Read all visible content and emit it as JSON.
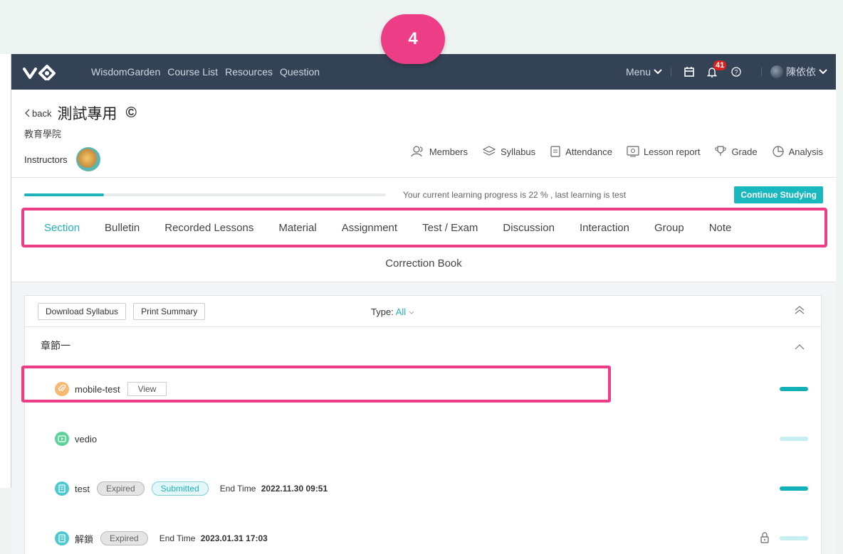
{
  "step_badge": "4",
  "topbar": {
    "brand": "WisdomGarden",
    "nav": [
      "Course List",
      "Resources",
      "Question"
    ],
    "menu_label": "Menu",
    "notification_count": "41",
    "user_name": "陳依依"
  },
  "course": {
    "back_label": "back",
    "title": "測試專用",
    "copyright_symbol": "©",
    "college": "教育學院",
    "instructors_label": "Instructors"
  },
  "tools": [
    {
      "label": "Members",
      "icon": "members-icon"
    },
    {
      "label": "Syllabus",
      "icon": "syllabus-icon"
    },
    {
      "label": "Attendance",
      "icon": "attendance-icon"
    },
    {
      "label": "Lesson report",
      "icon": "lesson-report-icon"
    },
    {
      "label": "Grade",
      "icon": "trophy-icon"
    },
    {
      "label": "Analysis",
      "icon": "pie-icon"
    }
  ],
  "progress": {
    "percent": 22,
    "text": "Your current learning progress is 22 % , last learning is test",
    "continue_label": "Continue Studying"
  },
  "tabs": [
    "Section",
    "Bulletin",
    "Recorded Lessons",
    "Material",
    "Assignment",
    "Test / Exam",
    "Discussion",
    "Interaction",
    "Group",
    "Note"
  ],
  "active_tab": "Section",
  "tab_second_row": "Correction Book",
  "toolbar": {
    "download_label": "Download Syllabus",
    "print_label": "Print Summary",
    "type_label": "Type:",
    "type_value": "All"
  },
  "chapter": {
    "title": "章節一"
  },
  "items": [
    {
      "name": "mobile-test",
      "icon": "link-icon",
      "icon_color": "#f5b971",
      "view_label": "View",
      "progress": "done"
    },
    {
      "name": "vedio",
      "icon": "video-icon",
      "icon_color": "#5dd39a",
      "progress": "none"
    },
    {
      "name": "test",
      "icon": "exam-icon",
      "icon_color": "#4fc9d0",
      "status": "Expired",
      "submitted": "Submitted",
      "end_label": "End Time",
      "end_time": "2022.11.30 09:51",
      "progress": "done"
    },
    {
      "name": "解鎖",
      "icon": "exam-icon",
      "icon_color": "#4fc9d0",
      "status": "Expired",
      "end_label": "End Time",
      "end_time": "2023.01.31 17:03",
      "progress": "none",
      "locked": true
    }
  ],
  "colors": {
    "accent": "#1fb2b8",
    "highlight": "#ec3d86",
    "topbar": "#334255"
  }
}
